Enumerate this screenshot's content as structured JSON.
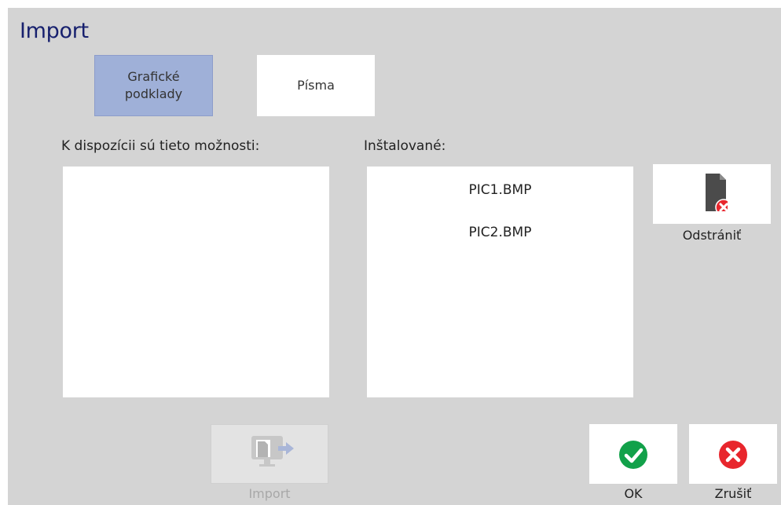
{
  "window": {
    "title": "Import"
  },
  "tabs": [
    {
      "label": "Grafické\npodklady",
      "selected": true
    },
    {
      "label": "Písma",
      "selected": false
    }
  ],
  "available": {
    "label": "K dispozícii sú tieto možnosti:",
    "items": []
  },
  "installed": {
    "label": "Inštalované:",
    "items": [
      "PIC1.BMP",
      "PIC2.BMP"
    ]
  },
  "buttons": {
    "remove": {
      "label": "Odstrániť",
      "icon": "delete-file-icon"
    },
    "import": {
      "label": "Import",
      "icon": "import-icon",
      "enabled": false
    },
    "ok": {
      "label": "OK",
      "icon": "checkmark-icon"
    },
    "cancel": {
      "label": "Zrušiť",
      "icon": "close-icon"
    }
  },
  "colors": {
    "title": "#17206e",
    "background": "#d4d4d4",
    "tab_selected": "#9fb0d8",
    "ok_green": "#12a14a",
    "cancel_red": "#e8262d"
  }
}
